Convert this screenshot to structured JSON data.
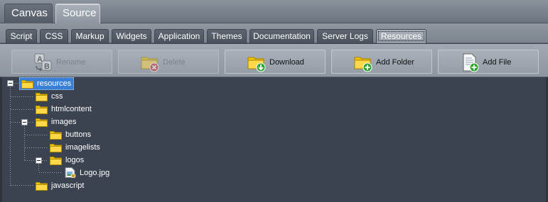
{
  "main_tabs": [
    {
      "label": "Canvas",
      "active": false
    },
    {
      "label": "Source",
      "active": true
    }
  ],
  "sub_tabs": [
    {
      "label": "Script"
    },
    {
      "label": "CSS"
    },
    {
      "label": "Markup"
    },
    {
      "label": "Widgets"
    },
    {
      "label": "Application"
    },
    {
      "label": "Themes"
    },
    {
      "label": "Documentation"
    },
    {
      "label": "Server Logs"
    },
    {
      "label": "Resources",
      "active": true
    }
  ],
  "toolbar": {
    "rename": {
      "label": "Rename",
      "icon": "rename-icon",
      "enabled": false
    },
    "delete": {
      "label": "Delete",
      "icon": "delete-folder-icon",
      "enabled": false
    },
    "download": {
      "label": "Download",
      "icon": "download-folder-icon",
      "enabled": true
    },
    "add_folder": {
      "label": "Add Folder",
      "icon": "add-folder-icon",
      "enabled": true
    },
    "add_file": {
      "label": "Add File",
      "icon": "add-file-icon",
      "enabled": true
    }
  },
  "tree": {
    "root": {
      "label": "resources",
      "selected": true,
      "expanded": true
    },
    "css": {
      "label": "css"
    },
    "htmlcontent": {
      "label": "htmlcontent"
    },
    "images": {
      "label": "images",
      "expanded": true
    },
    "buttons": {
      "label": "buttons"
    },
    "imagelists": {
      "label": "imagelists"
    },
    "logos": {
      "label": "logos",
      "expanded": true
    },
    "logo_jpg": {
      "label": "Logo.jpg",
      "icon": "image-file-icon"
    },
    "javascript": {
      "label": "javascript"
    }
  },
  "colors": {
    "panel_bg": "#3c4350",
    "selection": "#3a7fd6",
    "folder": "#f5c400",
    "green_plus": "#2fa52f",
    "red_x": "#d23a3a"
  }
}
